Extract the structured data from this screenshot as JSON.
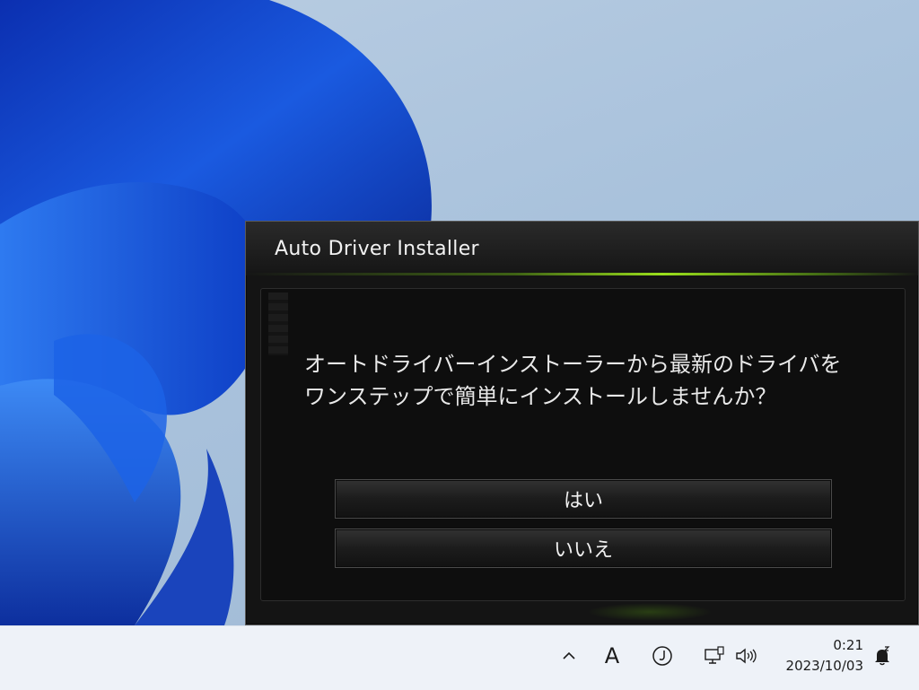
{
  "dialog": {
    "title": "Auto Driver Installer",
    "message": "オートドライバーインストーラーから最新のドライバをワンステップで簡単にインストールしませんか？",
    "yes_label": "はい",
    "no_label": "いいえ"
  },
  "taskbar": {
    "ime_indicator": "A",
    "time": "0:21",
    "date": "2023/10/03",
    "icons": [
      "chevron-up-icon",
      "ime-mode-icon",
      "network-icon",
      "volume-icon",
      "notification-bell-icon"
    ]
  },
  "colors": {
    "dialog_background": "#141414",
    "accent_green": "#9adf1c",
    "taskbar_background": "#eef2f8",
    "wallpaper_blue": "#1a56d6"
  }
}
